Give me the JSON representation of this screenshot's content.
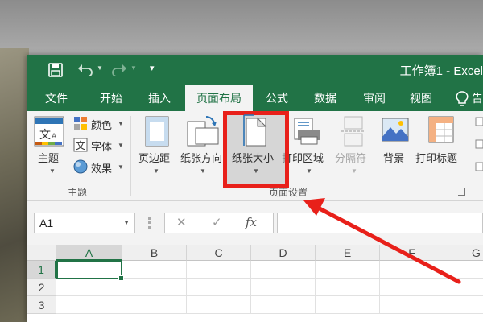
{
  "title": "工作簿1 - Excel",
  "tabs": [
    "文件",
    "开始",
    "插入",
    "页面布局",
    "公式",
    "数据",
    "审阅",
    "视图"
  ],
  "tell_me_icon": "lightbulb-icon",
  "ribbon": {
    "theme_group": {
      "themes_label": "主题",
      "colors_label": "颜色",
      "fonts_label": "字体",
      "effects_label": "效果",
      "group_label": "主题"
    },
    "page_setup_group": {
      "margins_label": "页边距",
      "orientation_label": "纸张方向",
      "size_label": "纸张大小",
      "print_area_label": "打印区域",
      "breaks_label": "分隔符",
      "background_label": "背景",
      "print_titles_label": "打印标题",
      "group_label": "页面设置"
    }
  },
  "formula_bar": {
    "name_box": "A1",
    "fx_label": "fx"
  },
  "columns": [
    "A",
    "B",
    "C",
    "D",
    "E",
    "F",
    "G"
  ],
  "rows": [
    "1",
    "2",
    "3"
  ],
  "annotation_color": "#e8201a",
  "accent_color": "#217346"
}
